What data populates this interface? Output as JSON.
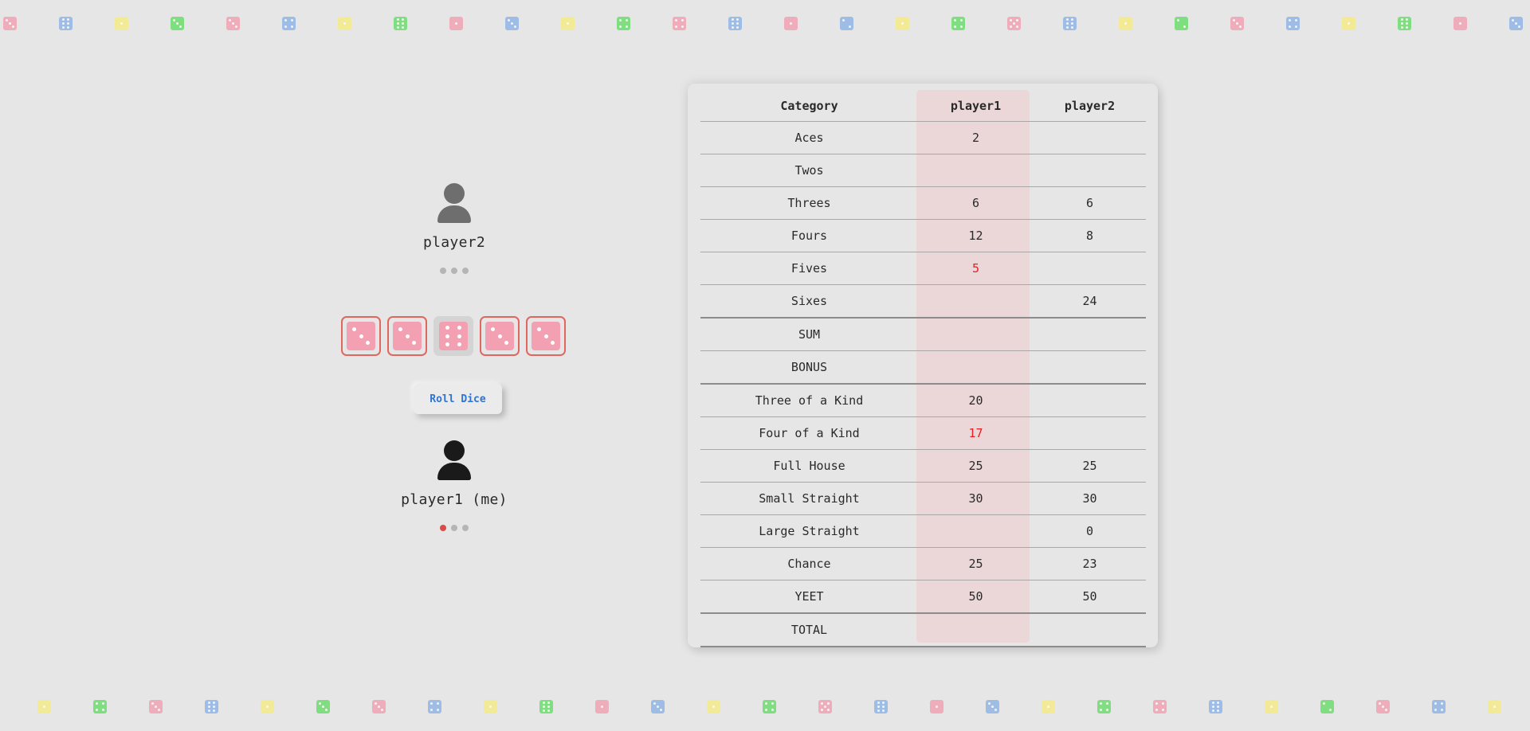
{
  "colors": {
    "pink": "#f2a0b2",
    "blue": "#8cb2e6",
    "yellow": "#f6ec82",
    "green": "#66dd66",
    "held_border": "#e0675f",
    "active_dot": "#d94a4a",
    "preview_score": "#e52020",
    "button_text": "#2f74d0"
  },
  "decor_dice": {
    "top": [
      {
        "color": "pink",
        "face": 3
      },
      {
        "color": "blue",
        "face": 6
      },
      {
        "color": "yellow",
        "face": 1
      },
      {
        "color": "green",
        "face": 3
      },
      {
        "color": "pink",
        "face": 3
      },
      {
        "color": "blue",
        "face": 4
      },
      {
        "color": "yellow",
        "face": 1
      },
      {
        "color": "green",
        "face": 6
      },
      {
        "color": "pink",
        "face": 1
      },
      {
        "color": "blue",
        "face": 3
      },
      {
        "color": "yellow",
        "face": 1
      },
      {
        "color": "green",
        "face": 4
      },
      {
        "color": "pink",
        "face": 4
      },
      {
        "color": "blue",
        "face": 6
      },
      {
        "color": "pink",
        "face": 1
      },
      {
        "color": "blue",
        "face": 2
      },
      {
        "color": "yellow",
        "face": 1
      },
      {
        "color": "green",
        "face": 4
      },
      {
        "color": "pink",
        "face": 5
      },
      {
        "color": "blue",
        "face": 6
      },
      {
        "color": "yellow",
        "face": 1
      },
      {
        "color": "green",
        "face": 2
      },
      {
        "color": "pink",
        "face": 3
      },
      {
        "color": "blue",
        "face": 4
      },
      {
        "color": "yellow",
        "face": 1
      },
      {
        "color": "green",
        "face": 6
      },
      {
        "color": "pink",
        "face": 1
      },
      {
        "color": "blue",
        "face": 3
      }
    ],
    "bottom": [
      {
        "color": "yellow",
        "face": 1
      },
      {
        "color": "green",
        "face": 4
      },
      {
        "color": "pink",
        "face": 3
      },
      {
        "color": "blue",
        "face": 6
      },
      {
        "color": "yellow",
        "face": 1
      },
      {
        "color": "green",
        "face": 3
      },
      {
        "color": "pink",
        "face": 3
      },
      {
        "color": "blue",
        "face": 4
      },
      {
        "color": "yellow",
        "face": 1
      },
      {
        "color": "green",
        "face": 6
      },
      {
        "color": "pink",
        "face": 1
      },
      {
        "color": "blue",
        "face": 3
      },
      {
        "color": "yellow",
        "face": 1
      },
      {
        "color": "green",
        "face": 4
      },
      {
        "color": "pink",
        "face": 5
      },
      {
        "color": "blue",
        "face": 6
      },
      {
        "color": "pink",
        "face": 1
      },
      {
        "color": "blue",
        "face": 3
      },
      {
        "color": "yellow",
        "face": 1
      },
      {
        "color": "green",
        "face": 4
      },
      {
        "color": "pink",
        "face": 4
      },
      {
        "color": "blue",
        "face": 6
      },
      {
        "color": "yellow",
        "face": 1
      },
      {
        "color": "green",
        "face": 2
      },
      {
        "color": "pink",
        "face": 3
      },
      {
        "color": "blue",
        "face": 4
      },
      {
        "color": "yellow",
        "face": 1
      }
    ]
  },
  "opponent": {
    "name": "player2",
    "avatar_icon": "person-icon",
    "avatar_color": "#6e6e6e",
    "rolls_used": 0,
    "roll_dots": 3
  },
  "me": {
    "name": "player1 (me)",
    "avatar_icon": "person-icon",
    "avatar_color": "#1a1a1a",
    "rolls_used": 1,
    "roll_dots": 3
  },
  "dice": [
    {
      "face": 3,
      "held": false
    },
    {
      "face": 3,
      "held": false
    },
    {
      "face": 6,
      "held": true
    },
    {
      "face": 3,
      "held": false
    },
    {
      "face": 3,
      "held": false
    }
  ],
  "roll_button_label": "Roll Dice",
  "scoreboard": {
    "headers": {
      "category": "Category",
      "p1": "player1",
      "p2": "player2"
    },
    "rows": [
      {
        "category": "Aces",
        "p1": "2",
        "p2": ""
      },
      {
        "category": "Twos",
        "p1": "",
        "p2": ""
      },
      {
        "category": "Threes",
        "p1": "6",
        "p2": "6"
      },
      {
        "category": "Fours",
        "p1": "12",
        "p2": "8"
      },
      {
        "category": "Fives",
        "p1": "5",
        "p2": "",
        "p1_preview": true
      },
      {
        "category": "Sixes",
        "p1": "",
        "p2": "24",
        "separator": true
      },
      {
        "category": "SUM",
        "p1": "",
        "p2": ""
      },
      {
        "category": "BONUS",
        "p1": "",
        "p2": "",
        "separator": true
      },
      {
        "category": "Three of a Kind",
        "p1": "20",
        "p2": ""
      },
      {
        "category": "Four of a Kind",
        "p1": "17",
        "p2": "",
        "p1_preview": true
      },
      {
        "category": "Full House",
        "p1": "25",
        "p2": "25"
      },
      {
        "category": "Small Straight",
        "p1": "30",
        "p2": "30"
      },
      {
        "category": "Large Straight",
        "p1": "",
        "p2": "0"
      },
      {
        "category": "Chance",
        "p1": "25",
        "p2": "23"
      },
      {
        "category": "YEET",
        "p1": "50",
        "p2": "50",
        "separator": true
      },
      {
        "category": "TOTAL",
        "p1": "",
        "p2": "",
        "separator": true
      }
    ]
  }
}
